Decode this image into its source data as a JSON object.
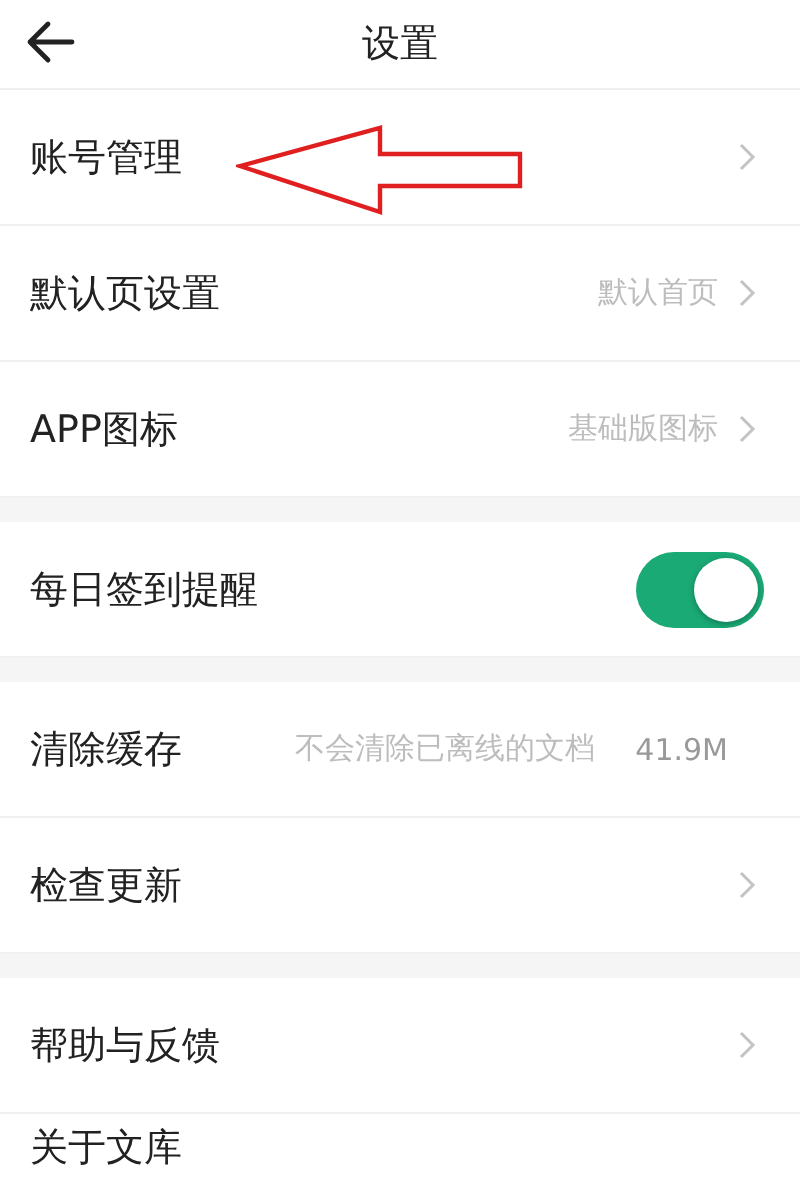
{
  "header": {
    "title": "设置"
  },
  "sections": [
    {
      "items": [
        {
          "kind": "link",
          "label": "账号管理"
        },
        {
          "kind": "link",
          "label": "默认页设置",
          "value": "默认首页"
        },
        {
          "kind": "link",
          "label": "APP图标",
          "value": "基础版图标"
        }
      ]
    },
    {
      "items": [
        {
          "kind": "toggle",
          "label": "每日签到提醒",
          "on": true
        }
      ]
    },
    {
      "items": [
        {
          "kind": "info",
          "label": "清除缓存",
          "hint": "不会清除已离线的文档",
          "value": "41.9M"
        },
        {
          "kind": "link",
          "label": "检查更新"
        }
      ]
    },
    {
      "items": [
        {
          "kind": "link",
          "label": "帮助与反馈"
        },
        {
          "kind": "plain",
          "label": "关于文库"
        }
      ]
    }
  ]
}
